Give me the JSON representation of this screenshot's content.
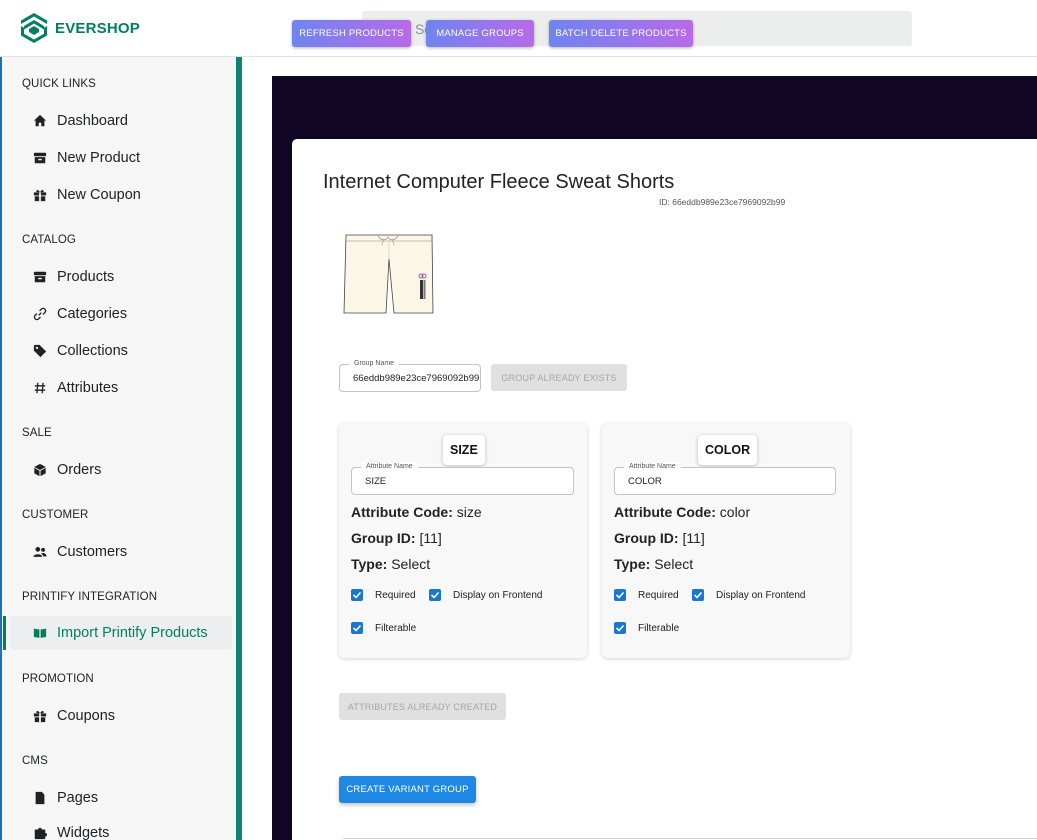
{
  "app": {
    "name": "EVERSHOP",
    "brand_color": "#008060"
  },
  "search": {
    "placeholder": "Search",
    "icon": "search-icon"
  },
  "sidebar": {
    "sections": [
      {
        "title": "QUICK LINKS",
        "items": [
          {
            "label": "Dashboard",
            "icon": "home-icon"
          },
          {
            "label": "New Product",
            "icon": "archive-icon"
          },
          {
            "label": "New Coupon",
            "icon": "gift-icon"
          }
        ]
      },
      {
        "title": "CATALOG",
        "items": [
          {
            "label": "Products",
            "icon": "archive-icon"
          },
          {
            "label": "Categories",
            "icon": "link-icon"
          },
          {
            "label": "Collections",
            "icon": "tag-icon"
          },
          {
            "label": "Attributes",
            "icon": "hash-icon"
          }
        ]
      },
      {
        "title": "SALE",
        "items": [
          {
            "label": "Orders",
            "icon": "cube-icon"
          }
        ]
      },
      {
        "title": "CUSTOMER",
        "items": [
          {
            "label": "Customers",
            "icon": "users-icon"
          }
        ]
      },
      {
        "title": "PRINTIFY INTEGRATION",
        "items": [
          {
            "label": "Import Printify Products",
            "icon": "book-open-icon",
            "active": true
          }
        ]
      },
      {
        "title": "PROMOTION",
        "items": [
          {
            "label": "Coupons",
            "icon": "gift-icon"
          }
        ]
      },
      {
        "title": "CMS",
        "items": [
          {
            "label": "Pages",
            "icon": "document-icon"
          },
          {
            "label": "Widgets",
            "icon": "puzzle-icon"
          }
        ]
      }
    ]
  },
  "toolbar": {
    "refresh_label": "REFRESH PRODUCTS",
    "manage_label": "MANAGE GROUPS",
    "batch_delete_label": "BATCH DELETE PRODUCTS"
  },
  "product": {
    "title": "Internet Computer Fleece Sweat Shorts",
    "id_text": "ID: 66eddb989e23ce7969092b99",
    "image": "sweat-shorts-image"
  },
  "group": {
    "label": "Group Name",
    "value": "66eddb989e23ce7969092b99",
    "exists_label": "GROUP ALREADY EXISTS"
  },
  "attributes": [
    {
      "badge": "SIZE",
      "field_label": "Attribute Name",
      "field_value": "SIZE",
      "code_label": "Attribute Code:",
      "code": "size",
      "group_label": "Group ID:",
      "group_id": "[11]",
      "type_label": "Type:",
      "type": "Select",
      "checks": {
        "required": "Required",
        "display": "Display on Frontend",
        "filterable": "Filterable"
      }
    },
    {
      "badge": "COLOR",
      "field_label": "Attribute Name",
      "field_value": "COLOR",
      "code_label": "Attribute Code:",
      "code": "color",
      "group_label": "Group ID:",
      "group_id": "[11]",
      "type_label": "Type:",
      "type": "Select",
      "checks": {
        "required": "Required",
        "display": "Display on Frontend",
        "filterable": "Filterable"
      }
    }
  ],
  "actions": {
    "attributes_created_label": "ATTRIBUTES ALREADY CREATED",
    "create_variant_label": "CREATE VARIANT GROUP"
  }
}
